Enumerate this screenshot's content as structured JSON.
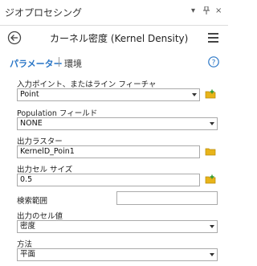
{
  "pane": {
    "title": "ジオプロセシング",
    "controls": {
      "menu": "▾",
      "pin": "ᵖ",
      "close": "×"
    }
  },
  "tool": {
    "title": "カーネル密度 (Kernel Density)"
  },
  "tabs": {
    "parameters": "パラメーター",
    "environments": "環境"
  },
  "params": {
    "input": {
      "label": "入力ポイント、またはライン フィーチャ",
      "value": "Point"
    },
    "population": {
      "label": "Population フィールド",
      "value": "NONE"
    },
    "output_raster": {
      "label": "出力ラスター",
      "value": "KernelD_Poin1"
    },
    "cell_size": {
      "label": "出力セル サイズ",
      "value": "0.5"
    },
    "search_radius": {
      "label": "検索範囲",
      "value": ""
    },
    "output_values": {
      "label": "出力のセル値",
      "value": "密度"
    },
    "method": {
      "label": "方法",
      "value": "平面"
    }
  },
  "colors": {
    "accent": "#2a76c6",
    "folder": "#e8b419",
    "plus": "#2e9a2e"
  },
  "icons": [
    "back-arrow-icon",
    "hamburger-menu-icon",
    "help-icon",
    "folder-icon",
    "dropdown-arrow-icon"
  ]
}
